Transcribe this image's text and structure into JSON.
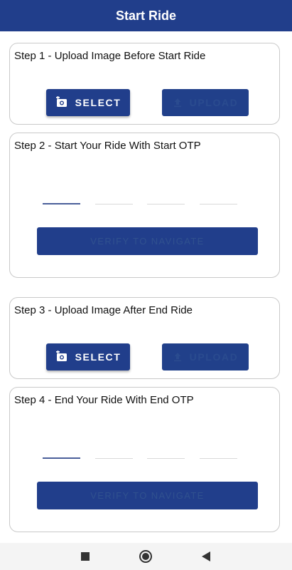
{
  "app_bar": {
    "title": "Start Ride"
  },
  "steps": [
    {
      "title": "Step 1 - Upload Image Before Start Ride",
      "select_label": "SELECT",
      "upload_label": "UPLOAD"
    },
    {
      "title": "Step 2 - Start Your Ride With Start OTP",
      "verify_label": "VERIFY TO NAVIGATE"
    },
    {
      "title": "Step 3 - Upload Image After End Ride",
      "select_label": "SELECT",
      "upload_label": "UPLOAD"
    },
    {
      "title": "Step 4 - End Your Ride With End OTP",
      "verify_label": "VERIFY TO NAVIGATE"
    }
  ],
  "icons": {
    "select": "add-photo-icon",
    "upload": "upload-icon",
    "nav_recent": "square-icon",
    "nav_home": "circle-icon",
    "nav_back": "triangle-back-icon"
  },
  "colors": {
    "primary": "#213e8b",
    "disabled_text": "#2a4b8f",
    "card_border": "#c9c9c9"
  }
}
